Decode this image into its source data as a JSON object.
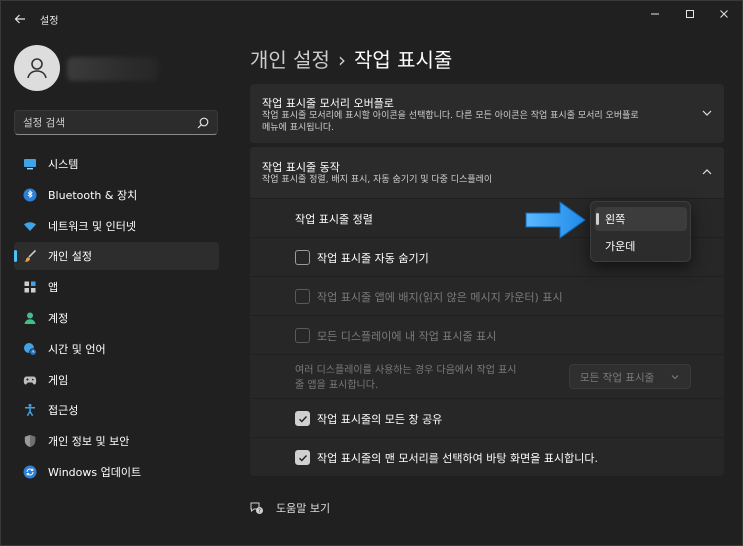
{
  "window": {
    "title": "설정"
  },
  "sidebar": {
    "search_placeholder": "설정 검색",
    "items": [
      {
        "label": "시스템",
        "icon": "monitor-icon",
        "active": false
      },
      {
        "label": "Bluetooth & 장치",
        "icon": "bluetooth-icon",
        "active": false
      },
      {
        "label": "네트워크 및 인터넷",
        "icon": "wifi-icon",
        "active": false
      },
      {
        "label": "개인 설정",
        "icon": "brush-icon",
        "active": true
      },
      {
        "label": "앱",
        "icon": "apps-icon",
        "active": false
      },
      {
        "label": "계정",
        "icon": "person-icon",
        "active": false
      },
      {
        "label": "시간 및 언어",
        "icon": "globe-clock-icon",
        "active": false
      },
      {
        "label": "게임",
        "icon": "gamepad-icon",
        "active": false
      },
      {
        "label": "접근성",
        "icon": "accessibility-icon",
        "active": false
      },
      {
        "label": "개인 정보 및 보안",
        "icon": "shield-icon",
        "active": false
      },
      {
        "label": "Windows 업데이트",
        "icon": "update-icon",
        "active": false
      }
    ]
  },
  "breadcrumb": {
    "parent": "개인 설정",
    "separator": "›",
    "current": "작업 표시줄"
  },
  "corner_overflow": {
    "title": "작업 표시줄 모서리 오버플로",
    "desc_line1": "작업 표시줄 모서리에 표시할 아이콘을 선택합니다. 다른 모든 아이콘은 작업 표시줄 모서리 오버플로",
    "desc_line2": "메뉴에 표시됩니다."
  },
  "behaviors": {
    "title": "작업 표시줄 동작",
    "desc": "작업 표시줄 정렬, 배지 표시, 자동 숨기기 및 다중 디스플레이",
    "alignment_label": "작업 표시줄 정렬",
    "alignment_options": [
      "왼쪽",
      "가운데"
    ],
    "alignment_selected": "왼쪽",
    "auto_hide": {
      "label": "작업 표시줄 자동 숨기기",
      "checked": false,
      "enabled": true
    },
    "badges": {
      "label": "작업 표시줄 앱에 배지(읽지 않은 메시지 카운터) 표시",
      "checked": false,
      "enabled": false
    },
    "all_displays": {
      "label": "모든 디스플레이에 내 작업 표시줄 표시",
      "checked": false,
      "enabled": false
    },
    "multi_display": {
      "desc_line1": "여러 디스플레이를 사용하는 경우 다음에서 작업 표시",
      "desc_line2": "줄 앱을 표시합니다.",
      "value": "모든 작업 표시줄"
    },
    "share_windows": {
      "label": "작업 표시줄의 모든 창 공유",
      "checked": true,
      "enabled": true
    },
    "show_desktop": {
      "label": "작업 표시줄의 맨 모서리를 선택하여 바탕 화면을 표시합니다.",
      "checked": true,
      "enabled": true
    }
  },
  "help": {
    "label": "도움말 보기"
  },
  "colors": {
    "accent": "#4cc2ff",
    "arrow": "#1e90e6",
    "background": "#202020",
    "card": "#2b2b2b"
  }
}
